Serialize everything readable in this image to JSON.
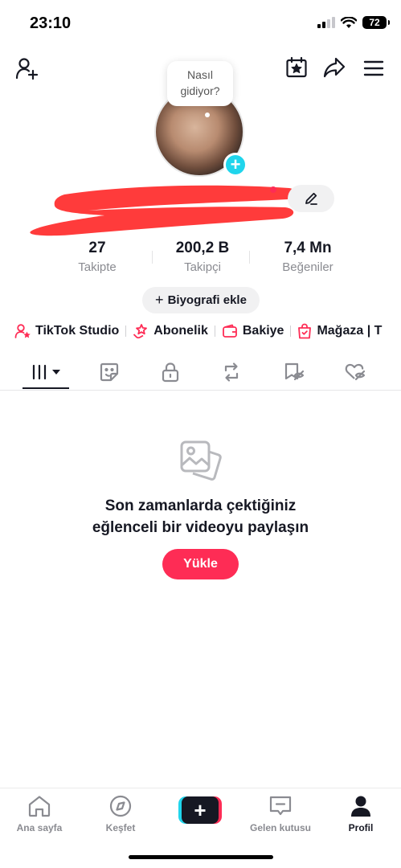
{
  "status_bar": {
    "time": "23:10",
    "battery": "72"
  },
  "profile": {
    "bubble_line1": "Nasıl",
    "bubble_line2": "gidiyor?"
  },
  "stats": [
    {
      "value": "27",
      "label": "Takipte"
    },
    {
      "value": "200,2 B",
      "label": "Takipçi"
    },
    {
      "value": "7,4 Mn",
      "label": "Beğeniler"
    }
  ],
  "bio_button": {
    "plus": "+",
    "label": "Biyografi ekle"
  },
  "shortcuts": [
    {
      "label": "TikTok Studio",
      "icon": "person-star-icon"
    },
    {
      "label": "Abonelik",
      "icon": "star-hand-icon"
    },
    {
      "label": "Bakiye",
      "icon": "wallet-icon"
    },
    {
      "label": "Mağaza | T",
      "icon": "shopping-bag-icon"
    }
  ],
  "tabs": [
    "videos-grid-icon",
    "sticker-icon",
    "lock-icon",
    "repost-icon",
    "favorites-icon",
    "liked-icon"
  ],
  "empty_state": {
    "line1": "Son zamanlarda çektiğiniz",
    "line2": "eğlenceli bir videoyu paylaşın",
    "upload_label": "Yükle"
  },
  "bottom_nav": {
    "home": "Ana sayfa",
    "discover": "Keşfet",
    "create": "+",
    "inbox": "Gelen kutusu",
    "profile": "Profil"
  },
  "colors": {
    "accent": "#fe2c55",
    "cyan": "#20d5ec",
    "text": "#161823",
    "muted": "#8a8b91"
  }
}
